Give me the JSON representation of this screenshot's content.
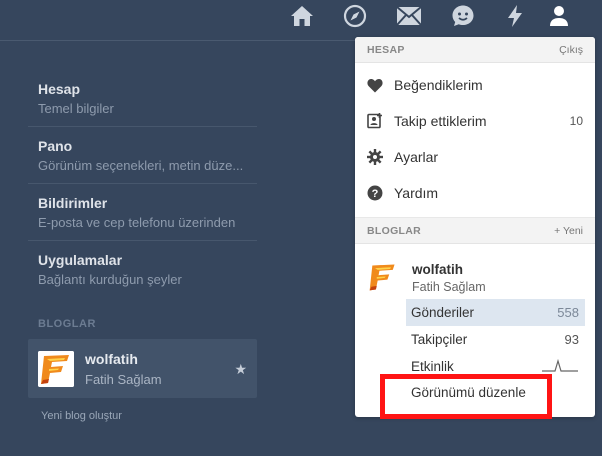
{
  "topnav": {
    "icons": [
      "home-icon",
      "compass-icon",
      "mail-icon",
      "emoji-icon",
      "lightning-icon",
      "account-icon"
    ]
  },
  "settings": {
    "items": [
      {
        "title": "Hesap",
        "subtitle": "Temel bilgiler"
      },
      {
        "title": "Pano",
        "subtitle": "Görünüm seçenekleri, metin düze..."
      },
      {
        "title": "Bildirimler",
        "subtitle": "E-posta ve cep telefonu üzerinden"
      },
      {
        "title": "Uygulamalar",
        "subtitle": "Bağlantı kurduğun şeyler"
      }
    ],
    "blogs_header": "BLOGLAR",
    "blog": {
      "name": "wolfatih",
      "subtitle": "Fatih Sağlam"
    },
    "new_blog": "Yeni blog oluştur"
  },
  "dropdown": {
    "account_header": "HESAP",
    "logout": "Çıkış",
    "items": [
      {
        "label": "Beğendiklerim",
        "count": ""
      },
      {
        "label": "Takip ettiklerim",
        "count": "10"
      },
      {
        "label": "Ayarlar",
        "count": ""
      },
      {
        "label": "Yardım",
        "count": ""
      }
    ],
    "blogs_header": "BLOGLAR",
    "new_blog": "+ Yeni",
    "blog": {
      "name": "wolfatih",
      "subtitle": "Fatih Sağlam"
    },
    "stats": [
      {
        "label": "Gönderiler",
        "value": "558"
      },
      {
        "label": "Takipçiler",
        "value": "93"
      },
      {
        "label": "Etkinlik",
        "value": ""
      }
    ],
    "edit_appearance": "Görünümü düzenle"
  },
  "colors": {
    "background": "#36465d",
    "highlight": "#ff1414",
    "active_stat": "#dde6f0"
  }
}
